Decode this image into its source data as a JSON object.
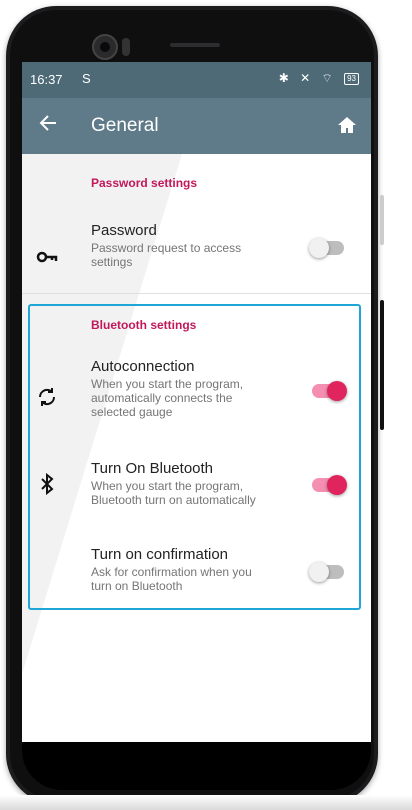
{
  "status_bar": {
    "time": "16:37",
    "notification_glyph": "S",
    "icons": "✱ ✕ ⌔",
    "battery": "93"
  },
  "app_bar": {
    "title": "General",
    "back_icon": "arrow-left-icon",
    "home_icon": "home-icon"
  },
  "password_section": {
    "header": "Password settings",
    "items": [
      {
        "title": "Password",
        "subtitle": "Password request to access settings",
        "icon": "key-icon",
        "enabled": false
      }
    ]
  },
  "bluetooth_section": {
    "header": "Bluetooth settings",
    "items": [
      {
        "title": "Autoconnection",
        "subtitle": "When you start the program, automatically connects the selected gauge",
        "icon": "sync-icon",
        "enabled": true
      },
      {
        "title": "Turn On Bluetooth",
        "subtitle": "When you start the program, Bluetooth turn on automatically",
        "icon": "bluetooth-icon",
        "enabled": true
      },
      {
        "title": "Turn on confirmation",
        "subtitle": "Ask for confirmation when you turn on Bluetooth",
        "icon": "",
        "enabled": false
      }
    ]
  },
  "colors": {
    "status_bar": "#4e6a77",
    "app_bar": "#5f7a88",
    "accent": "#e0245e",
    "section_header": "#c2185b",
    "highlight_border": "#1fa6d6"
  }
}
